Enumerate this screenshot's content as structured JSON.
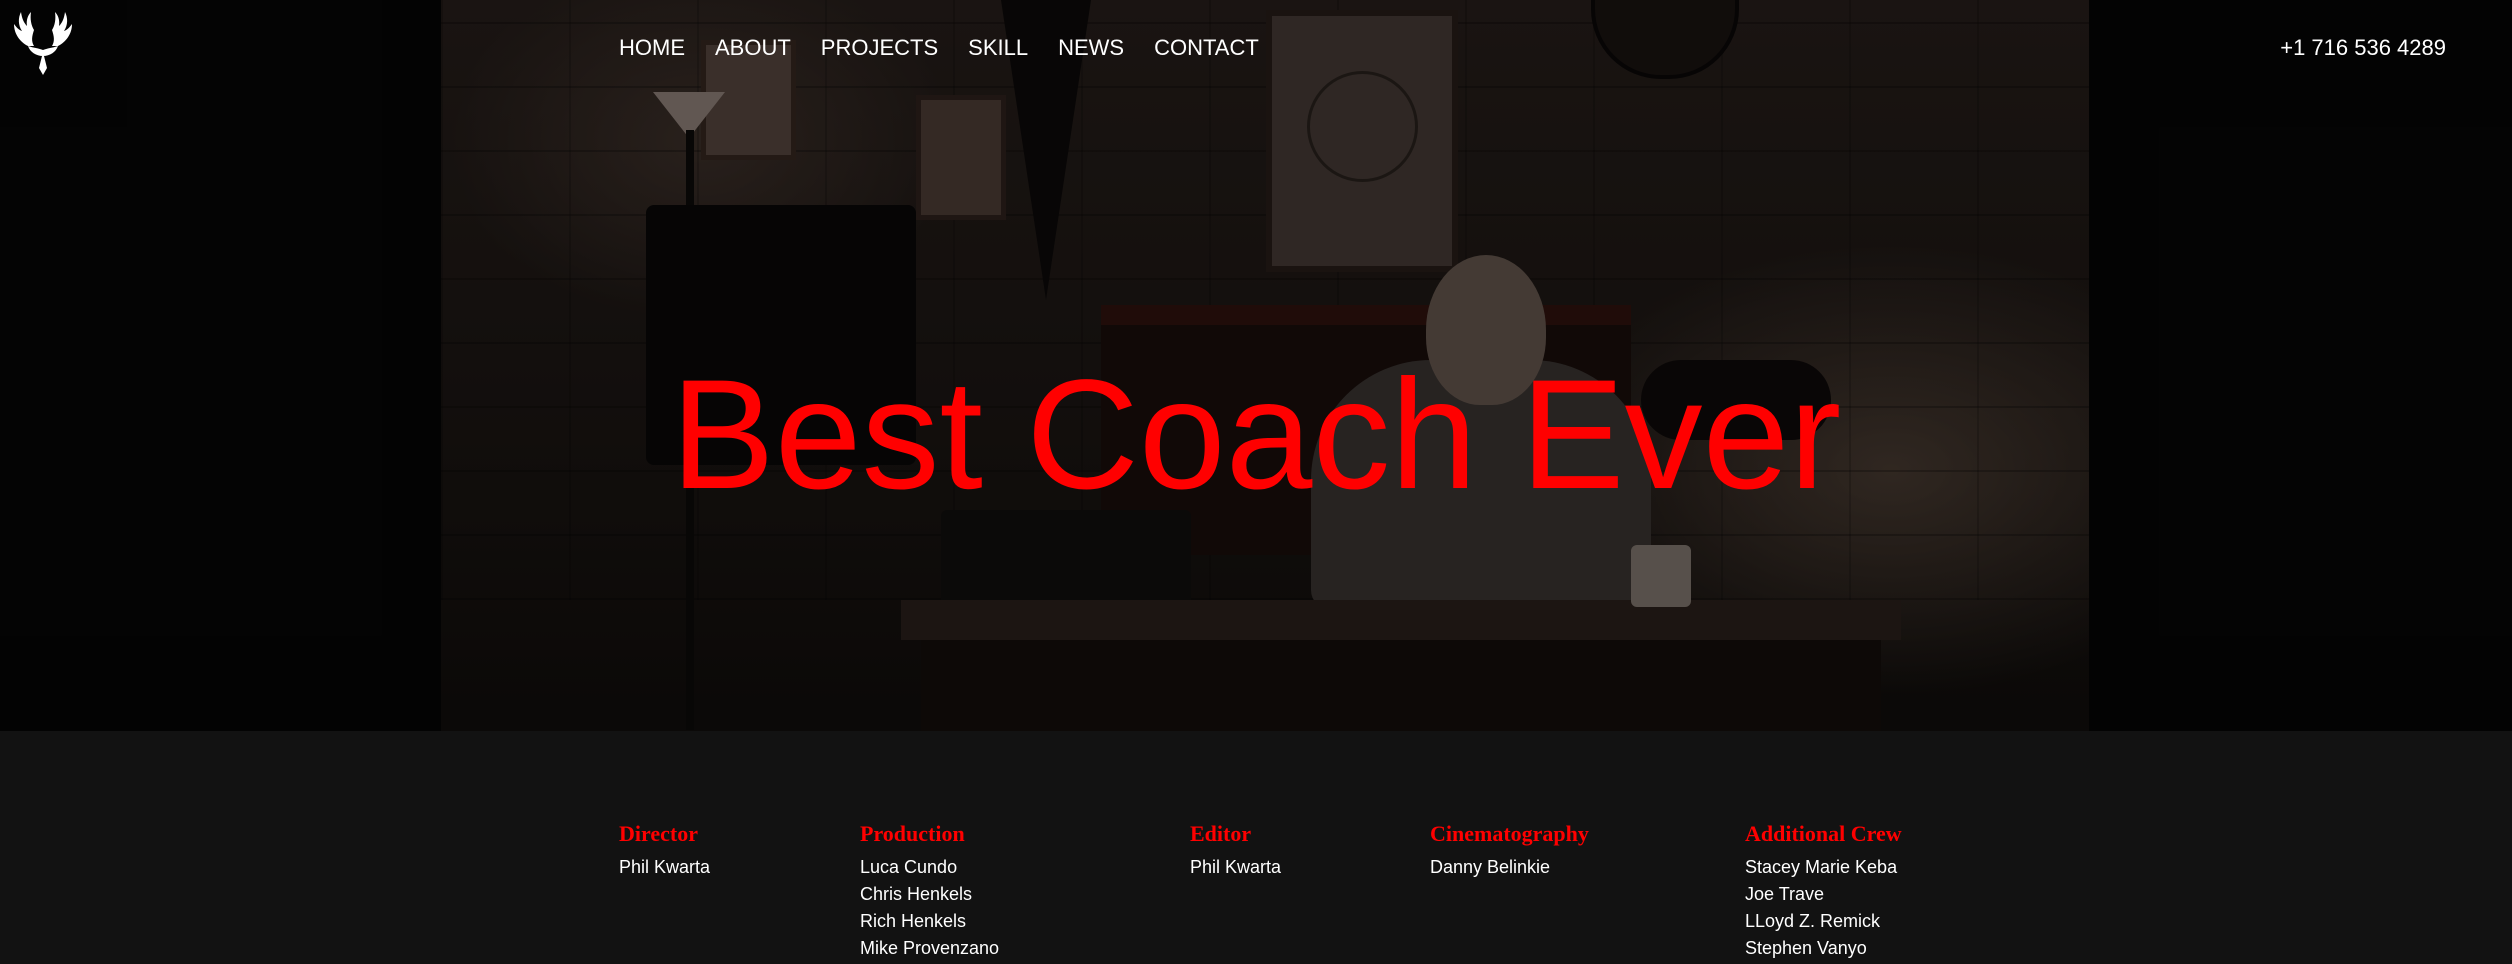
{
  "header": {
    "logo_icon": "deer-antlers-logo-icon",
    "nav": [
      {
        "label": "HOME"
      },
      {
        "label": "ABOUT"
      },
      {
        "label": "PROJECTS"
      },
      {
        "label": "SKILL"
      },
      {
        "label": "NEWS"
      },
      {
        "label": "CONTACT"
      }
    ],
    "phone": "+1 716 536 4289"
  },
  "hero": {
    "title": "Best Coach Ever"
  },
  "credits": [
    {
      "role": "Director",
      "names": [
        "Phil Kwarta"
      ]
    },
    {
      "role": "Production",
      "names": [
        "Luca Cundo",
        "Chris Henkels",
        "Rich Henkels",
        "Mike Provenzano"
      ]
    },
    {
      "role": "Editor",
      "names": [
        "Phil Kwarta"
      ]
    },
    {
      "role": "Cinematography",
      "names": [
        "Danny Belinkie"
      ]
    },
    {
      "role": "Additional Crew",
      "names": [
        "Stacey Marie Keba",
        "Joe Trave",
        "LLoyd Z. Remick",
        "Stephen Vanyo"
      ]
    }
  ],
  "colors": {
    "accent": "#ff0000",
    "background": "#121212",
    "text": "#ffffff"
  }
}
